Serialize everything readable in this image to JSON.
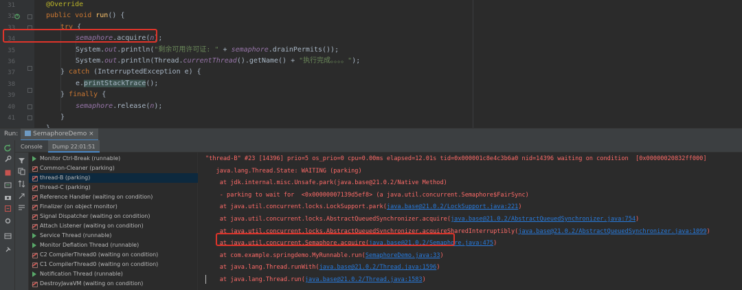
{
  "editor": {
    "line_numbers": [
      "31",
      "32",
      "33",
      "34",
      "35",
      "36",
      "37",
      "38",
      "39",
      "40",
      "41"
    ],
    "lines": [
      {
        "id": "l31",
        "segments": [
          {
            "t": "@Override",
            "c": "ann"
          }
        ]
      },
      {
        "id": "l32",
        "segments": [
          {
            "t": "public ",
            "c": "kw"
          },
          {
            "t": "void ",
            "c": "kw"
          },
          {
            "t": "run",
            "c": "mth"
          },
          {
            "t": "() {",
            "c": ""
          }
        ]
      },
      {
        "id": "l33",
        "segments": [
          {
            "t": "try ",
            "c": "kw"
          },
          {
            "t": "{",
            "c": ""
          }
        ]
      },
      {
        "id": "l34",
        "segments": [
          {
            "t": "semaphore",
            "c": "fld"
          },
          {
            "t": ".acquire(",
            "c": ""
          },
          {
            "t": "n",
            "c": "fld"
          },
          {
            "t": ");",
            "c": ""
          }
        ]
      },
      {
        "id": "l35",
        "segments": [
          {
            "t": "System.",
            "c": ""
          },
          {
            "t": "out",
            "c": "fld"
          },
          {
            "t": ".println(",
            "c": ""
          },
          {
            "t": "\"剩余可用许可证: \"",
            "c": "str"
          },
          {
            "t": " + ",
            "c": ""
          },
          {
            "t": "semaphore",
            "c": "fld"
          },
          {
            "t": ".drainPermits());",
            "c": ""
          }
        ]
      },
      {
        "id": "l36",
        "segments": [
          {
            "t": "System.",
            "c": ""
          },
          {
            "t": "out",
            "c": "fld"
          },
          {
            "t": ".println(Thread.",
            "c": ""
          },
          {
            "t": "currentThread",
            "c": "fld"
          },
          {
            "t": "().getName() + ",
            "c": ""
          },
          {
            "t": "\"执行完成。。。。\"",
            "c": "str"
          },
          {
            "t": ");",
            "c": ""
          }
        ]
      },
      {
        "id": "l37",
        "segments": [
          {
            "t": "} ",
            "c": ""
          },
          {
            "t": "catch ",
            "c": "kw"
          },
          {
            "t": "(InterruptedException e) {",
            "c": ""
          }
        ]
      },
      {
        "id": "l38",
        "segments": [
          {
            "t": "e.",
            "c": ""
          },
          {
            "t": "printStackTrace",
            "c": "hl"
          },
          {
            "t": "();",
            "c": ""
          }
        ]
      },
      {
        "id": "l39",
        "segments": [
          {
            "t": "} ",
            "c": ""
          },
          {
            "t": "finally ",
            "c": "kw"
          },
          {
            "t": "{",
            "c": ""
          }
        ]
      },
      {
        "id": "l40",
        "segments": [
          {
            "t": "semaphore",
            "c": "fld"
          },
          {
            "t": ".release(",
            "c": ""
          },
          {
            "t": "n",
            "c": "fld"
          },
          {
            "t": ");",
            "c": ""
          }
        ]
      },
      {
        "id": "l41",
        "segments": [
          {
            "t": "}",
            "c": ""
          }
        ]
      },
      {
        "id": "l42",
        "segments": [
          {
            "t": "}",
            "c": ""
          }
        ]
      }
    ]
  },
  "run_window": {
    "label": "Run:",
    "config_tab": "SemaphoreDemo",
    "subtabs": {
      "console": "Console",
      "dump": "Dump 22:01:51"
    }
  },
  "threads": [
    {
      "name": "Monitor Ctrl-Break (runnable)",
      "state": "run"
    },
    {
      "name": "Common-Cleaner (parking)",
      "state": "wait"
    },
    {
      "name": "thread-B (parking)",
      "state": "wait",
      "selected": true
    },
    {
      "name": "thread-C (parking)",
      "state": "wait"
    },
    {
      "name": "Reference Handler (waiting on condition)",
      "state": "wait"
    },
    {
      "name": "Finalizer (on object monitor)",
      "state": "wait"
    },
    {
      "name": "Signal Dispatcher (waiting on condition)",
      "state": "wait"
    },
    {
      "name": "Attach Listener (waiting on condition)",
      "state": "wait"
    },
    {
      "name": "Service Thread (runnable)",
      "state": "run"
    },
    {
      "name": "Monitor Deflation Thread (runnable)",
      "state": "run"
    },
    {
      "name": "C2 CompilerThread0 (waiting on condition)",
      "state": "wait"
    },
    {
      "name": "C1 CompilerThread0 (waiting on condition)",
      "state": "wait"
    },
    {
      "name": "Notification Thread (runnable)",
      "state": "run"
    },
    {
      "name": "DestroyJavaVM (waiting on condition)",
      "state": "wait"
    }
  ],
  "stack": [
    {
      "segments": [
        {
          "t": "\"thread-B\" #23 [14396] prio=5 os_prio=0 cpu=0.00ms elapsed=12.01s tid=0x000001c8e4c3b6a0 nid=14396 waiting on condition  [0x00000020832ff000]",
          "c": "serr"
        }
      ]
    },
    {
      "segments": [
        {
          "t": "   java.lang.Thread.State: WAITING (parking)",
          "c": "serr"
        }
      ]
    },
    {
      "segments": [
        {
          "t": "    at jdk.internal.misc.Unsafe.park(java.base@21.0.2/Native Method)",
          "c": "serr"
        }
      ]
    },
    {
      "segments": [
        {
          "t": "    - parking to wait for  <0x00000007139d5ef8> (a java.util.concurrent.Semaphore$FairSync)",
          "c": "serr"
        }
      ]
    },
    {
      "segments": [
        {
          "t": "    at ",
          "c": "serr"
        },
        {
          "t": "java.util.concurrent.locks.LockSupport.park",
          "c": "serr"
        },
        {
          "t": "(",
          "c": "serr"
        },
        {
          "t": "java.base@21.0.2/LockSupport.java:221",
          "c": "slink"
        },
        {
          "t": ")",
          "c": "serr"
        }
      ]
    },
    {
      "segments": [
        {
          "t": "    at java.util.concurrent.locks.AbstractQueuedSynchronizer.acquire(",
          "c": "serr"
        },
        {
          "t": "java.base@21.0.2/AbstractQueuedSynchronizer.java:754",
          "c": "slink"
        },
        {
          "t": ")",
          "c": "serr"
        }
      ]
    },
    {
      "segments": [
        {
          "t": "    at java.util.concurrent.locks.AbstractQueuedSynchronizer.acquireSharedInterruptibly(",
          "c": "serr"
        },
        {
          "t": "java.base@21.0.2/AbstractQueuedSynchronizer.java:1099",
          "c": "slink"
        },
        {
          "t": ")",
          "c": "serr"
        }
      ]
    },
    {
      "segments": [
        {
          "t": "    at java.util.concurrent.Semaphore.acquire(",
          "c": "serr"
        },
        {
          "t": "java.base@21.0.2/Semaphore.java:475",
          "c": "slink"
        },
        {
          "t": ")",
          "c": "serr"
        }
      ]
    },
    {
      "segments": [
        {
          "t": "    at ",
          "c": "serr"
        },
        {
          "t": "com.example.springdemo.MyRunnable.run",
          "c": "serr"
        },
        {
          "t": "(",
          "c": "serr"
        },
        {
          "t": "SemaphoreDemo.java:33",
          "c": "slink"
        },
        {
          "t": ")",
          "c": "serr"
        }
      ]
    },
    {
      "segments": [
        {
          "t": "    at java.lang.Thread.runWith(",
          "c": "serr"
        },
        {
          "t": "java.base@21.0.2/Thread.java:1596",
          "c": "slink"
        },
        {
          "t": ")",
          "c": "serr"
        }
      ]
    },
    {
      "segments": [
        {
          "t": "    at java.lang.Thread.run(",
          "c": "serr"
        },
        {
          "t": "java.base@21.0.2/Thread.java:1583",
          "c": "slink"
        },
        {
          "t": ")",
          "c": "serr"
        }
      ]
    }
  ]
}
